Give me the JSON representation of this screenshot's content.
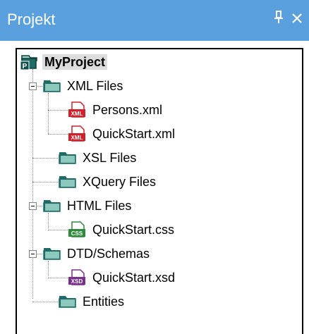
{
  "window": {
    "title": "Projekt",
    "pin_glyph": "📌",
    "close_glyph": "✕"
  },
  "tree": {
    "root_label": "MyProject",
    "folders": {
      "xml": "XML Files",
      "xsl": "XSL Files",
      "xquery": "XQuery Files",
      "html": "HTML Files",
      "dtd": "DTD/Schemas",
      "entities": "Entities"
    },
    "files": {
      "persons_xml": "Persons.xml",
      "quickstart_xml": "QuickStart.xml",
      "quickstart_css": "QuickStart.css",
      "quickstart_xsd": "QuickStart.xsd"
    }
  },
  "icons": {
    "project": "project-icon",
    "folder": "folder-icon",
    "xml_file": "xml-file-icon",
    "css_file": "css-file-icon",
    "xsd_file": "xsd-file-icon"
  },
  "icon_text": {
    "project": "P",
    "xml": "XML",
    "css": "CSS",
    "xsd": "XSD"
  },
  "colors": {
    "title_bar": "#5aa0de",
    "folder_fill": "#6db3a5",
    "folder_dark": "#1f6b67",
    "xml_badge": "#d0212a",
    "css_badge": "#2e8b3a",
    "xsd_badge": "#7a2e8e"
  }
}
